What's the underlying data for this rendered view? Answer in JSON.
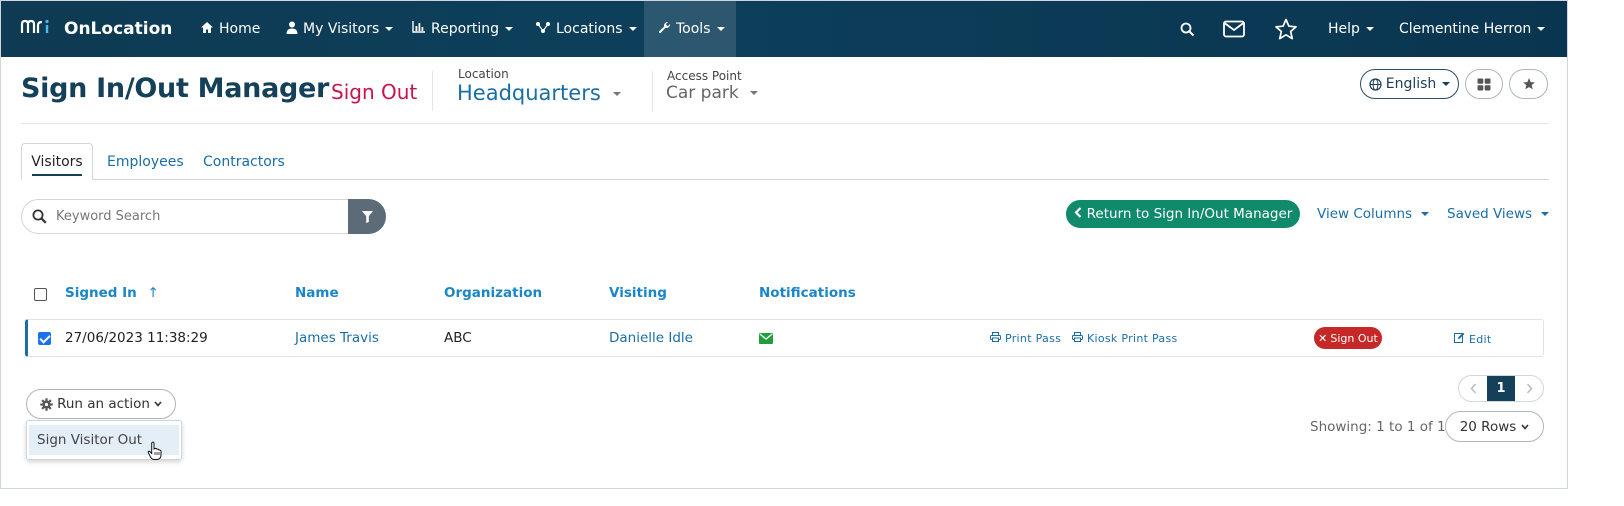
{
  "nav": {
    "brand_logo": "mri",
    "brand_name": "OnLocation",
    "items": [
      {
        "label": "Home",
        "icon": "home-icon"
      },
      {
        "label": "My Visitors",
        "icon": "user-icon"
      },
      {
        "label": "Reporting",
        "icon": "bar-chart-icon"
      },
      {
        "label": "Locations",
        "icon": "network-icon"
      },
      {
        "label": "Tools",
        "icon": "wrench-icon"
      }
    ],
    "help_label": "Help",
    "user_name": "Clementine Herron"
  },
  "header": {
    "title": "Sign In/Out Manager",
    "mode_link": "Sign Out",
    "location_label": "Location",
    "location_value": "Headquarters",
    "access_point_label": "Access Point",
    "access_point_value": "Car park",
    "language": "English"
  },
  "tabs": [
    {
      "label": "Visitors",
      "active": true
    },
    {
      "label": "Employees",
      "active": false
    },
    {
      "label": "Contractors",
      "active": false
    }
  ],
  "toolbar": {
    "search_placeholder": "Keyword Search",
    "return_label": "Return to Sign In/Out Manager",
    "view_columns_label": "View Columns",
    "saved_views_label": "Saved Views"
  },
  "table": {
    "columns": [
      "Signed In",
      "Name",
      "Organization",
      "Visiting",
      "Notifications"
    ],
    "sort_indicator": "↑",
    "rows": [
      {
        "checked": true,
        "signed_in": "27/06/2023 11:38:29",
        "name": "James Travis",
        "organization": "ABC",
        "visiting": "Danielle Idle",
        "print_pass": "Print Pass",
        "kiosk_print_pass": "Kiosk Print Pass",
        "sign_out": "Sign Out",
        "edit": "Edit"
      }
    ]
  },
  "actions": {
    "run_label": "Run an action",
    "menu_items": [
      "Sign Visitor Out"
    ]
  },
  "pagination": {
    "current_page": "1",
    "showing_text": "Showing: 1 to 1 of 1",
    "rows_label": "20 Rows"
  },
  "colors": {
    "navbar": "#0d3f5b",
    "accent_link": "#1a6ea6",
    "signout_red": "#c8144b",
    "return_green": "#0f8a6a",
    "badge_red": "#c62828"
  }
}
